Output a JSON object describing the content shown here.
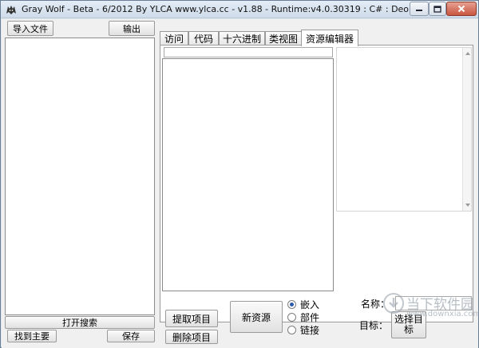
{
  "window": {
    "title": "Gray Wolf - Beta - 6/2012  By YLCA  www.ylca.cc - v1.88 - Runtime:v4.0.30319 : C# : Deobfuscation"
  },
  "left": {
    "import_label": "导入文件",
    "export_label": "输出",
    "search_label": "打开搜索",
    "find_main_label": "找到主要",
    "save_label": "保存"
  },
  "tabs": [
    {
      "label": "访问"
    },
    {
      "label": "代码"
    },
    {
      "label": "十六进制"
    },
    {
      "label": "类视图"
    },
    {
      "label": "资源编辑器",
      "active": true
    }
  ],
  "resource": {
    "extract_label": "提取项目",
    "new_label": "新资源",
    "delete_label": "删除项目",
    "radio_options": [
      {
        "label": "嵌入",
        "selected": true
      },
      {
        "label": "部件",
        "selected": false
      },
      {
        "label": "链接",
        "selected": false
      }
    ],
    "name_label": "名称：",
    "target_label": "目标：",
    "select_target_label": "选择目标"
  },
  "watermark": {
    "text": "当下软件园",
    "url": "www.downxia.com"
  },
  "colors": {
    "titlebar": "#cfdbe9",
    "close_button": "#c8553f",
    "radio_selected": "#2a5aa8"
  }
}
